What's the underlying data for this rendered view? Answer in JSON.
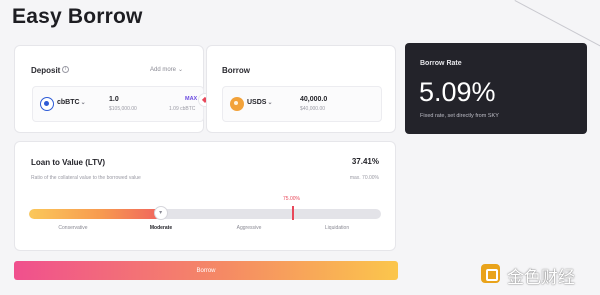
{
  "page": {
    "title": "Easy Borrow"
  },
  "deposit": {
    "label": "Deposit",
    "add_more": "Add more",
    "token": "cbBTC",
    "amount": "1.0",
    "amount_usd": "$105,000.00",
    "max_label": "MAX",
    "balance": "1.09 cbBTC"
  },
  "borrow": {
    "label": "Borrow",
    "token": "USDS",
    "amount": "40,000.0",
    "amount_usd": "$40,000.00"
  },
  "rate": {
    "title": "Borrow Rate",
    "value": "5.09%",
    "description": "Fixed rate, set directly from SKY"
  },
  "ltv": {
    "title": "Loan to Value (LTV)",
    "value_text": "37.41%",
    "value": 37.41,
    "description": "Ratio of the collateral value to the borrowed value",
    "max_text": "max. 70.00%",
    "liquidation_text": "75.00%",
    "liquidation_value": 75,
    "zones": [
      {
        "label": "Conservative",
        "active": false
      },
      {
        "label": "Moderate",
        "active": true
      },
      {
        "label": "Aggressive",
        "active": false
      },
      {
        "label": "Liquidation",
        "active": false
      }
    ]
  },
  "action": {
    "label": "Borrow"
  },
  "watermark": {
    "text": "金色财经"
  },
  "colors": {
    "accent_purple": "#6b4be0",
    "liquidation_red": "#e8485a",
    "dark_card": "#23232a"
  },
  "icons": {
    "info": "info-icon",
    "chevron": "chevron-down-icon",
    "swap": "swap-icon",
    "slider": "slider-handle-icon"
  }
}
